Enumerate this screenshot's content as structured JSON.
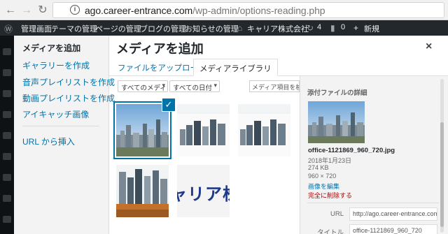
{
  "browser": {
    "back_icon": "arrow-left-icon",
    "forward_icon": "arrow-right-icon",
    "reload_icon": "reload-icon",
    "info_icon_glyph": "i",
    "url_host": "ago.career-entrance.com",
    "url_path": "/wp-admin/options-reading.php"
  },
  "admin_bar": {
    "items": [
      "管理画面",
      "テーマの管理",
      "ページの管理",
      "ブログの管理",
      "お知らせの管理",
      "キャリア株式会社",
      "4",
      "0",
      "新規"
    ]
  },
  "modal": {
    "title": "メディアを追加",
    "close_glyph": "×",
    "menu_title": "メディアを追加",
    "menu_items": [
      "ギャラリーを作成",
      "音声プレイリストを作成",
      "動画プレイリストを作成",
      "アイキャッチ画像"
    ],
    "menu_insert_url": "URL から挿入",
    "tabs": {
      "upload": "ファイルをアップロード",
      "library": "メディアライブラリ"
    },
    "filters": {
      "type": "すべてのメディア",
      "date": "すべての日付",
      "search_placeholder": "メディア項目を検索"
    },
    "thumbs": [
      {
        "kind": "city",
        "selected": true
      },
      {
        "kind": "city",
        "selected": false
      },
      {
        "kind": "city",
        "selected": false
      },
      {
        "kind": "city-autumn",
        "selected": false
      },
      {
        "kind": "banner",
        "text": "ャリア株"
      }
    ],
    "check_glyph": "✓",
    "details": {
      "heading": "添付ファイルの詳細",
      "filename": "office-1121869_960_720.jpg",
      "date": "2018年1月23日",
      "size": "274 KB",
      "dimensions": "960 × 720",
      "edit_link": "画像を編集",
      "delete_link": "完全に削除する",
      "url_label": "URL",
      "url_value": "http://ago.career-entrance.com/wp-content/uploads/",
      "title_label": "タイトル",
      "title_value": "office-1121869_960_720"
    }
  },
  "colors": {
    "accent": "#0073aa",
    "danger": "#a00000",
    "admin_bar": "#23282d"
  }
}
